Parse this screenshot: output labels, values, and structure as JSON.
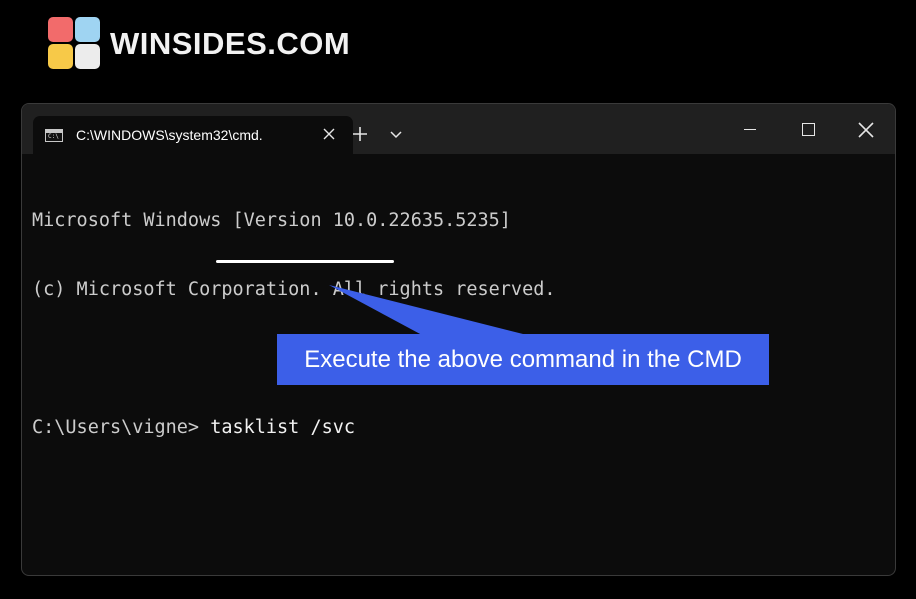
{
  "brand": {
    "name": "WINSIDES.COM",
    "tile_colors": [
      "#f26b6b",
      "#9fd4f2",
      "#f7c948",
      "#ececec"
    ]
  },
  "window": {
    "tab_title": "C:\\WINDOWS\\system32\\cmd.",
    "tab_icon": "cmd-icon",
    "new_tab_icon": "plus-icon",
    "dropdown_icon": "chevron-down-icon"
  },
  "console": {
    "lines": [
      "Microsoft Windows [Version 10.0.22635.5235]",
      "(c) Microsoft Corporation. All rights reserved.",
      ""
    ],
    "prompt": "C:\\Users\\vigne> ",
    "command": "tasklist /svc"
  },
  "annotation": {
    "text": "Execute the above command in the CMD",
    "color": "#3c5fe8"
  }
}
